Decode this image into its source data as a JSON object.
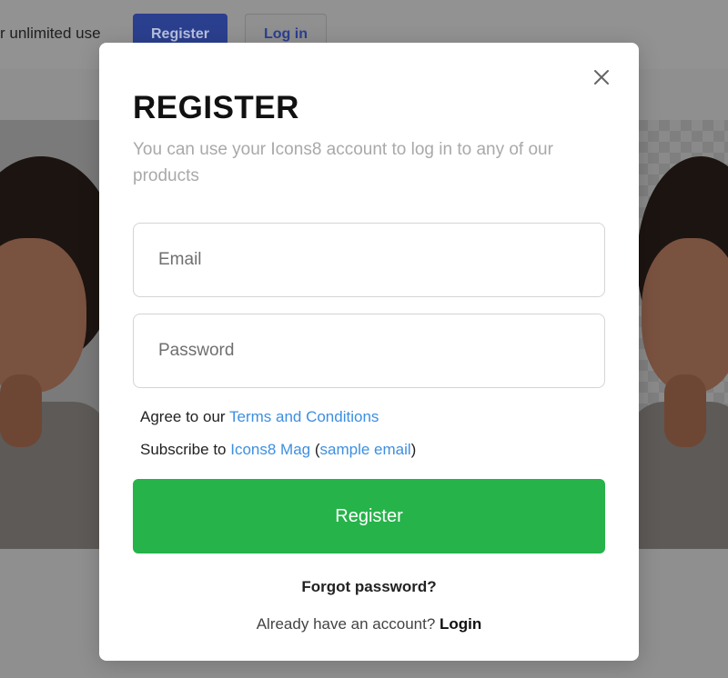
{
  "background": {
    "promo_text": "r unlimited use",
    "register_label": "Register",
    "login_label": "Log in"
  },
  "modal": {
    "close_icon": "close-icon",
    "title": "REGISTER",
    "subtitle": "You can use your Icons8 account to log in to any of our products",
    "email": {
      "placeholder": "Email",
      "value": ""
    },
    "password": {
      "placeholder": "Password",
      "value": ""
    },
    "agree_prefix": "Agree to our ",
    "terms_link": "Terms and Conditions",
    "subscribe_prefix": "Subscribe to ",
    "mag_link": "Icons8 Mag",
    "paren_open": " (",
    "sample_link": "sample email",
    "paren_close": ")",
    "register_button": "Register",
    "forgot_password": "Forgot password?",
    "already_text": "Already have an account? ",
    "login_link": "Login"
  },
  "colors": {
    "accent_green": "#26b34a",
    "link_blue": "#3d8fe0",
    "overlay": "#8f8f8f"
  }
}
